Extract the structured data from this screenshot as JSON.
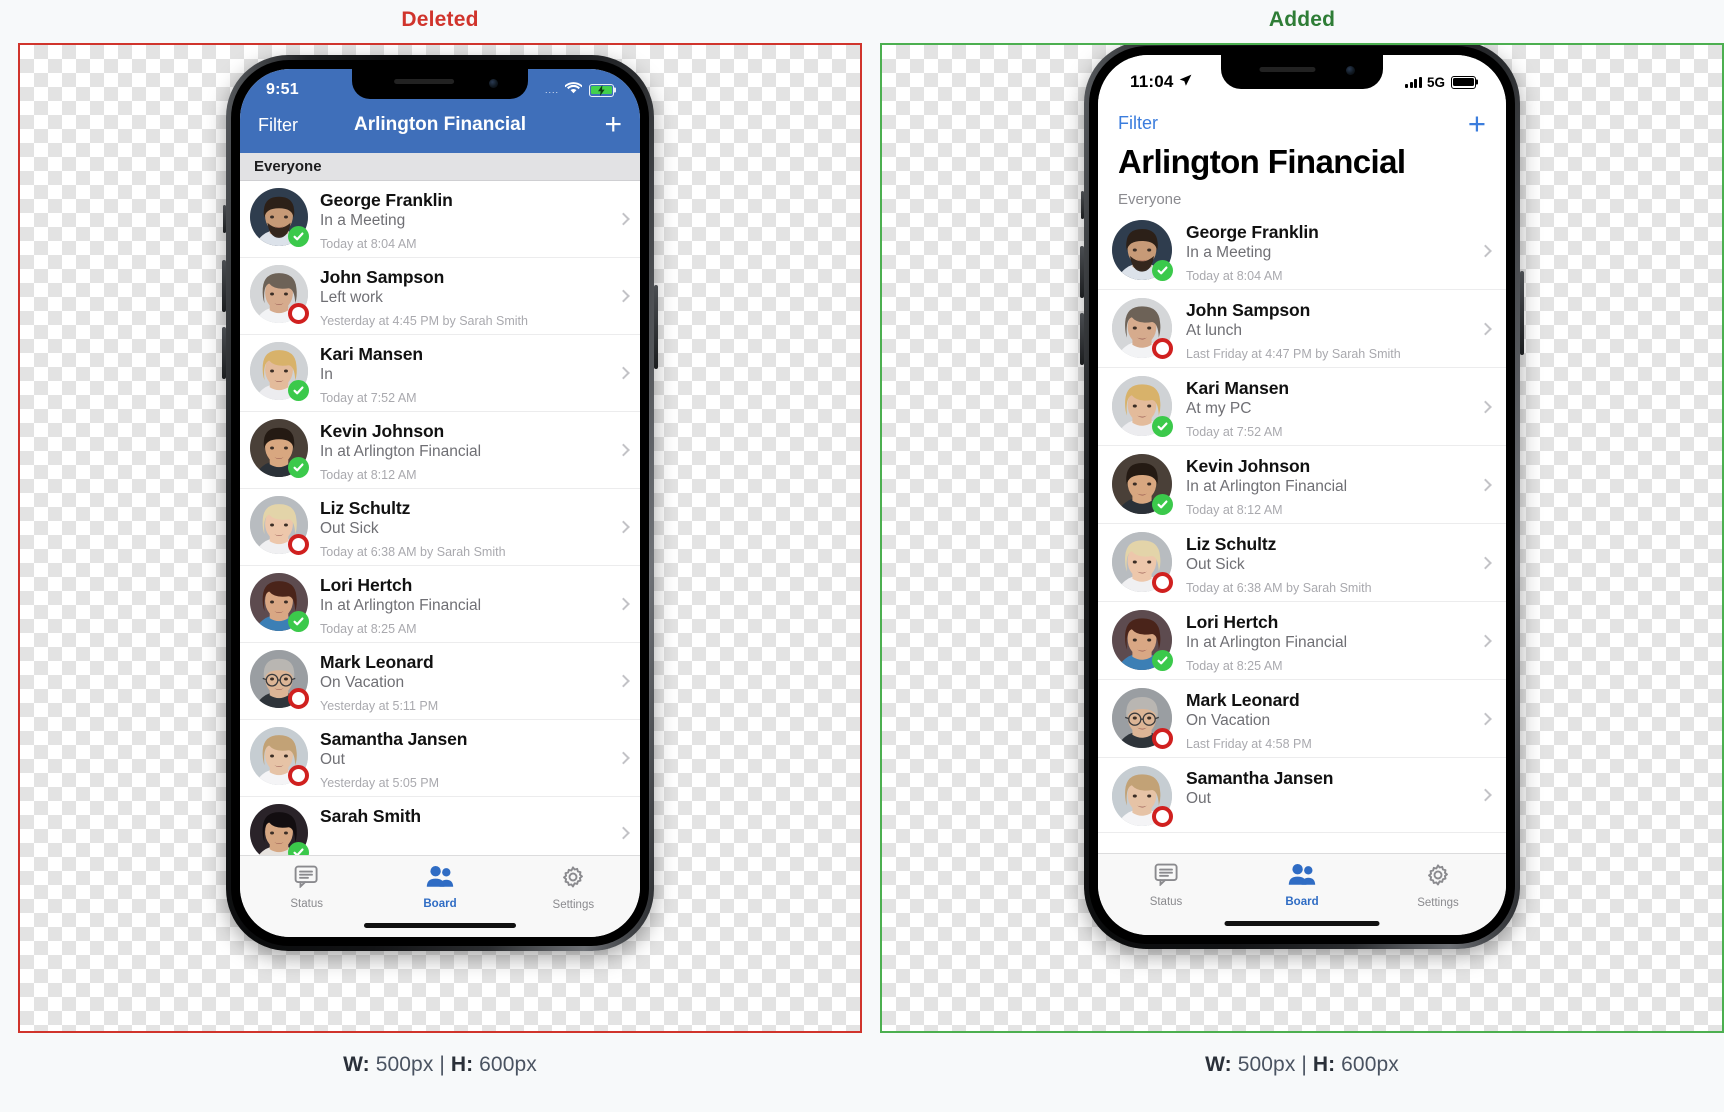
{
  "comparison": {
    "left": {
      "title": "Deleted",
      "border_color": "#d0342c",
      "title_color": "#d0342c",
      "caption_w_label": "W:",
      "caption_w_value": "500px",
      "caption_sep": "|",
      "caption_h_label": "H:",
      "caption_h_value": "600px"
    },
    "right": {
      "title": "Added",
      "border_color": "#4caf50",
      "title_color": "#2e7d36",
      "caption_w_label": "W:",
      "caption_w_value": "500px",
      "caption_sep": "|",
      "caption_h_label": "H:",
      "caption_h_value": "600px"
    }
  },
  "old_phone": {
    "status_bar": {
      "time": "9:51",
      "carrier_dots": "....",
      "wifi": "wifi-icon",
      "battery": "battery-charging-icon"
    },
    "nav": {
      "left_label": "Filter",
      "title": "Arlington Financial",
      "add_label": "+"
    },
    "section_header": "Everyone",
    "accent": "#3f6fba",
    "rows": [
      {
        "name": "George Franklin",
        "status": "In a Meeting",
        "time": "Today at 8:04 AM",
        "presence": "in"
      },
      {
        "name": "John Sampson",
        "status": "Left work",
        "time": "Yesterday at 4:45 PM by Sarah Smith",
        "presence": "out"
      },
      {
        "name": "Kari Mansen",
        "status": "In",
        "time": "Today at 7:52 AM",
        "presence": "in"
      },
      {
        "name": "Kevin Johnson",
        "status": "In at Arlington Financial",
        "time": "Today at 8:12 AM",
        "presence": "in"
      },
      {
        "name": "Liz Schultz",
        "status": "Out Sick",
        "time": "Today at 6:38 AM by Sarah Smith",
        "presence": "out"
      },
      {
        "name": "Lori Hertch",
        "status": "In at Arlington Financial",
        "time": "Today at 8:25 AM",
        "presence": "in"
      },
      {
        "name": "Mark Leonard",
        "status": "On Vacation",
        "time": "Yesterday at 5:11 PM",
        "presence": "out"
      },
      {
        "name": "Samantha Jansen",
        "status": "Out",
        "time": "Yesterday at 5:05 PM",
        "presence": "out"
      },
      {
        "name": "Sarah Smith",
        "status": "",
        "time": "",
        "presence": "in"
      }
    ],
    "tabs": [
      {
        "label": "Status",
        "icon": "chat-bubble-icon",
        "active": false
      },
      {
        "label": "Board",
        "icon": "people-icon",
        "active": true
      },
      {
        "label": "Settings",
        "icon": "gear-icon",
        "active": false
      }
    ]
  },
  "new_phone": {
    "status_bar": {
      "time": "11:04",
      "location": "location-arrow-icon",
      "signal": "cellular-bars-icon",
      "network": "5G",
      "battery": "battery-icon"
    },
    "nav": {
      "left_label": "Filter",
      "add_label": "+"
    },
    "large_title": "Arlington Financial",
    "section_header": "Everyone",
    "accent": "#3b7ddd",
    "rows": [
      {
        "name": "George Franklin",
        "status": "In a Meeting",
        "time": "Today at 8:04 AM",
        "presence": "in"
      },
      {
        "name": "John Sampson",
        "status": "At lunch",
        "time": "Last Friday at 4:47 PM by Sarah Smith",
        "presence": "out"
      },
      {
        "name": "Kari Mansen",
        "status": "At my PC",
        "time": "Today at 7:52 AM",
        "presence": "in"
      },
      {
        "name": "Kevin Johnson",
        "status": "In at Arlington Financial",
        "time": "Today at 8:12 AM",
        "presence": "in"
      },
      {
        "name": "Liz Schultz",
        "status": "Out Sick",
        "time": "Today at 6:38 AM by Sarah Smith",
        "presence": "out"
      },
      {
        "name": "Lori Hertch",
        "status": "In at Arlington Financial",
        "time": "Today at 8:25 AM",
        "presence": "in"
      },
      {
        "name": "Mark Leonard",
        "status": "On Vacation",
        "time": "Last Friday at 4:58 PM",
        "presence": "out"
      },
      {
        "name": "Samantha Jansen",
        "status": "Out",
        "time": "",
        "presence": "out"
      }
    ],
    "tabs": [
      {
        "label": "Status",
        "icon": "chat-bubble-icon",
        "active": false
      },
      {
        "label": "Board",
        "icon": "people-icon",
        "active": true
      },
      {
        "label": "Settings",
        "icon": "gear-icon",
        "active": false
      }
    ]
  }
}
